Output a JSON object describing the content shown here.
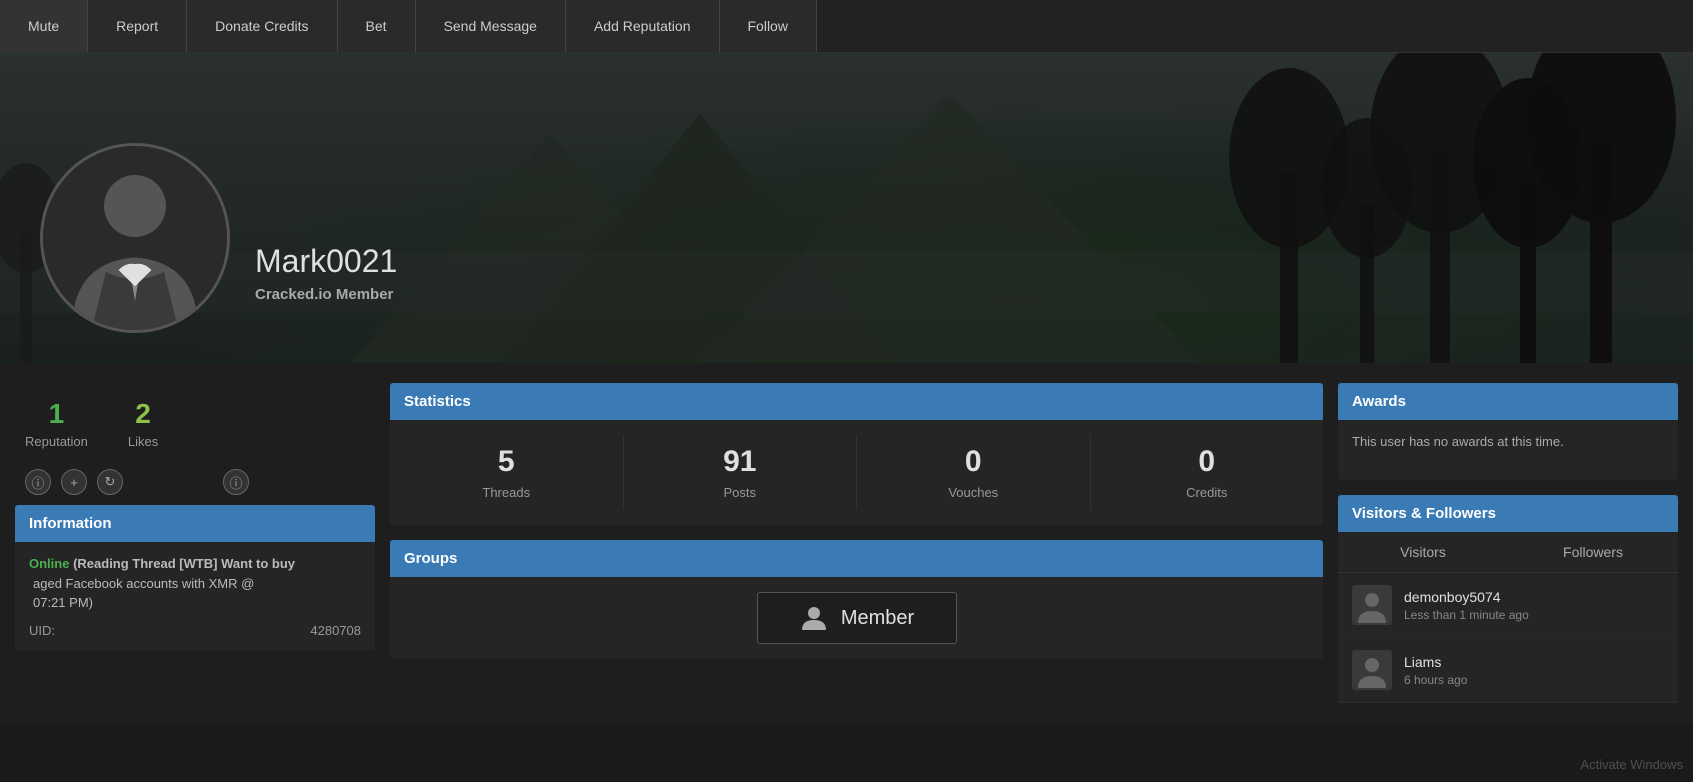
{
  "toolbar": {
    "buttons": [
      {
        "label": "Mute",
        "name": "mute-button"
      },
      {
        "label": "Report",
        "name": "report-button"
      },
      {
        "label": "Donate Credits",
        "name": "donate-credits-button"
      },
      {
        "label": "Bet",
        "name": "bet-button"
      },
      {
        "label": "Send Message",
        "name": "send-message-button"
      },
      {
        "label": "Add Reputation",
        "name": "add-reputation-button"
      },
      {
        "label": "Follow",
        "name": "follow-button"
      }
    ]
  },
  "profile": {
    "username": "Mark0021",
    "rank": "Cracked.io Member",
    "reputation": "1",
    "likes": "2",
    "reputation_label": "Reputation",
    "likes_label": "Likes",
    "uid_label": "UID:",
    "uid_value": "4280708"
  },
  "information": {
    "header": "Information",
    "status_label": "Online",
    "status_text": "(Reading Thread [WTB] Want to buy",
    "status_text2": "aged Facebook accounts with XMR @",
    "status_time": "07:21 PM)"
  },
  "statistics": {
    "header": "Statistics",
    "cells": [
      {
        "value": "5",
        "label": "Threads"
      },
      {
        "value": "91",
        "label": "Posts"
      },
      {
        "value": "0",
        "label": "Vouches"
      },
      {
        "value": "0",
        "label": "Credits"
      }
    ]
  },
  "groups": {
    "header": "Groups",
    "member_label": "Member"
  },
  "awards": {
    "header": "Awards",
    "empty_text": "This user has no awards at this time."
  },
  "visitors_followers": {
    "header": "Visitors & Followers",
    "tabs": [
      "Visitors",
      "Followers"
    ],
    "visitors": [
      {
        "name": "demonboy5074",
        "time": "Less than 1 minute ago"
      },
      {
        "name": "Liams",
        "time": "6 hours ago"
      }
    ]
  },
  "watermark": "Activate Windows"
}
